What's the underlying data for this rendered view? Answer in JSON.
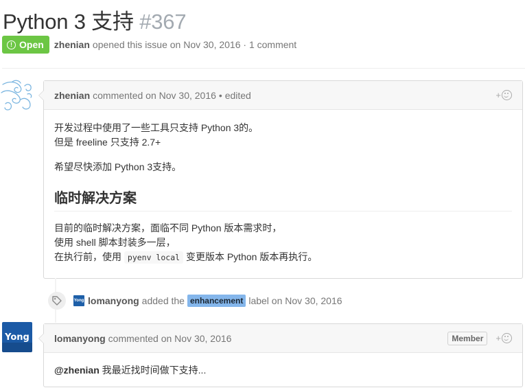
{
  "issue": {
    "title": "Python 3 支持",
    "number": "#367",
    "state": "Open",
    "author": "zhenian",
    "meta_text": "opened this issue on Nov 30, 2016 · 1 comment"
  },
  "comments": [
    {
      "author": "zhenian",
      "meta": "commented on Nov 30, 2016",
      "edited": "• edited",
      "reaction_plus": "+",
      "body": {
        "line1": "开发过程中使用了一些工具只支持 Python 3的。",
        "line2_pre": "但是 ",
        "line2_code": "freeline",
        "line2_post": " 只支持 2.7+",
        "line3": "希望尽快添加 Python 3支持。",
        "heading": "临时解决方案",
        "line4": "目前的临时解决方案，面临不同 Python 版本需求时，",
        "line5_pre": "使用 ",
        "line5_code": "shell",
        "line5_post": " 脚本封装多一层，",
        "line6_pre": "在执行前，使用 ",
        "line6_code": "pyenv local",
        "line6_post": " 变更版本 Python 版本再执行。"
      }
    },
    {
      "author": "lomanyong",
      "meta": "commented on Nov 30, 2016",
      "badge": "Member",
      "reaction_plus": "+",
      "mention": "@zhenian",
      "text": " 我最近找时间做下支持..."
    }
  ],
  "event": {
    "actor": "lomanyong",
    "avatar_text": "Yong",
    "pre": "added the",
    "label": "enhancement",
    "post": "label on Nov 30, 2016"
  },
  "avatar_yong_text": "Yong",
  "colors": {
    "open_green": "#6cc644",
    "label_enhancement": "#84b6eb",
    "avatar_blue": "#1b5aa6"
  }
}
